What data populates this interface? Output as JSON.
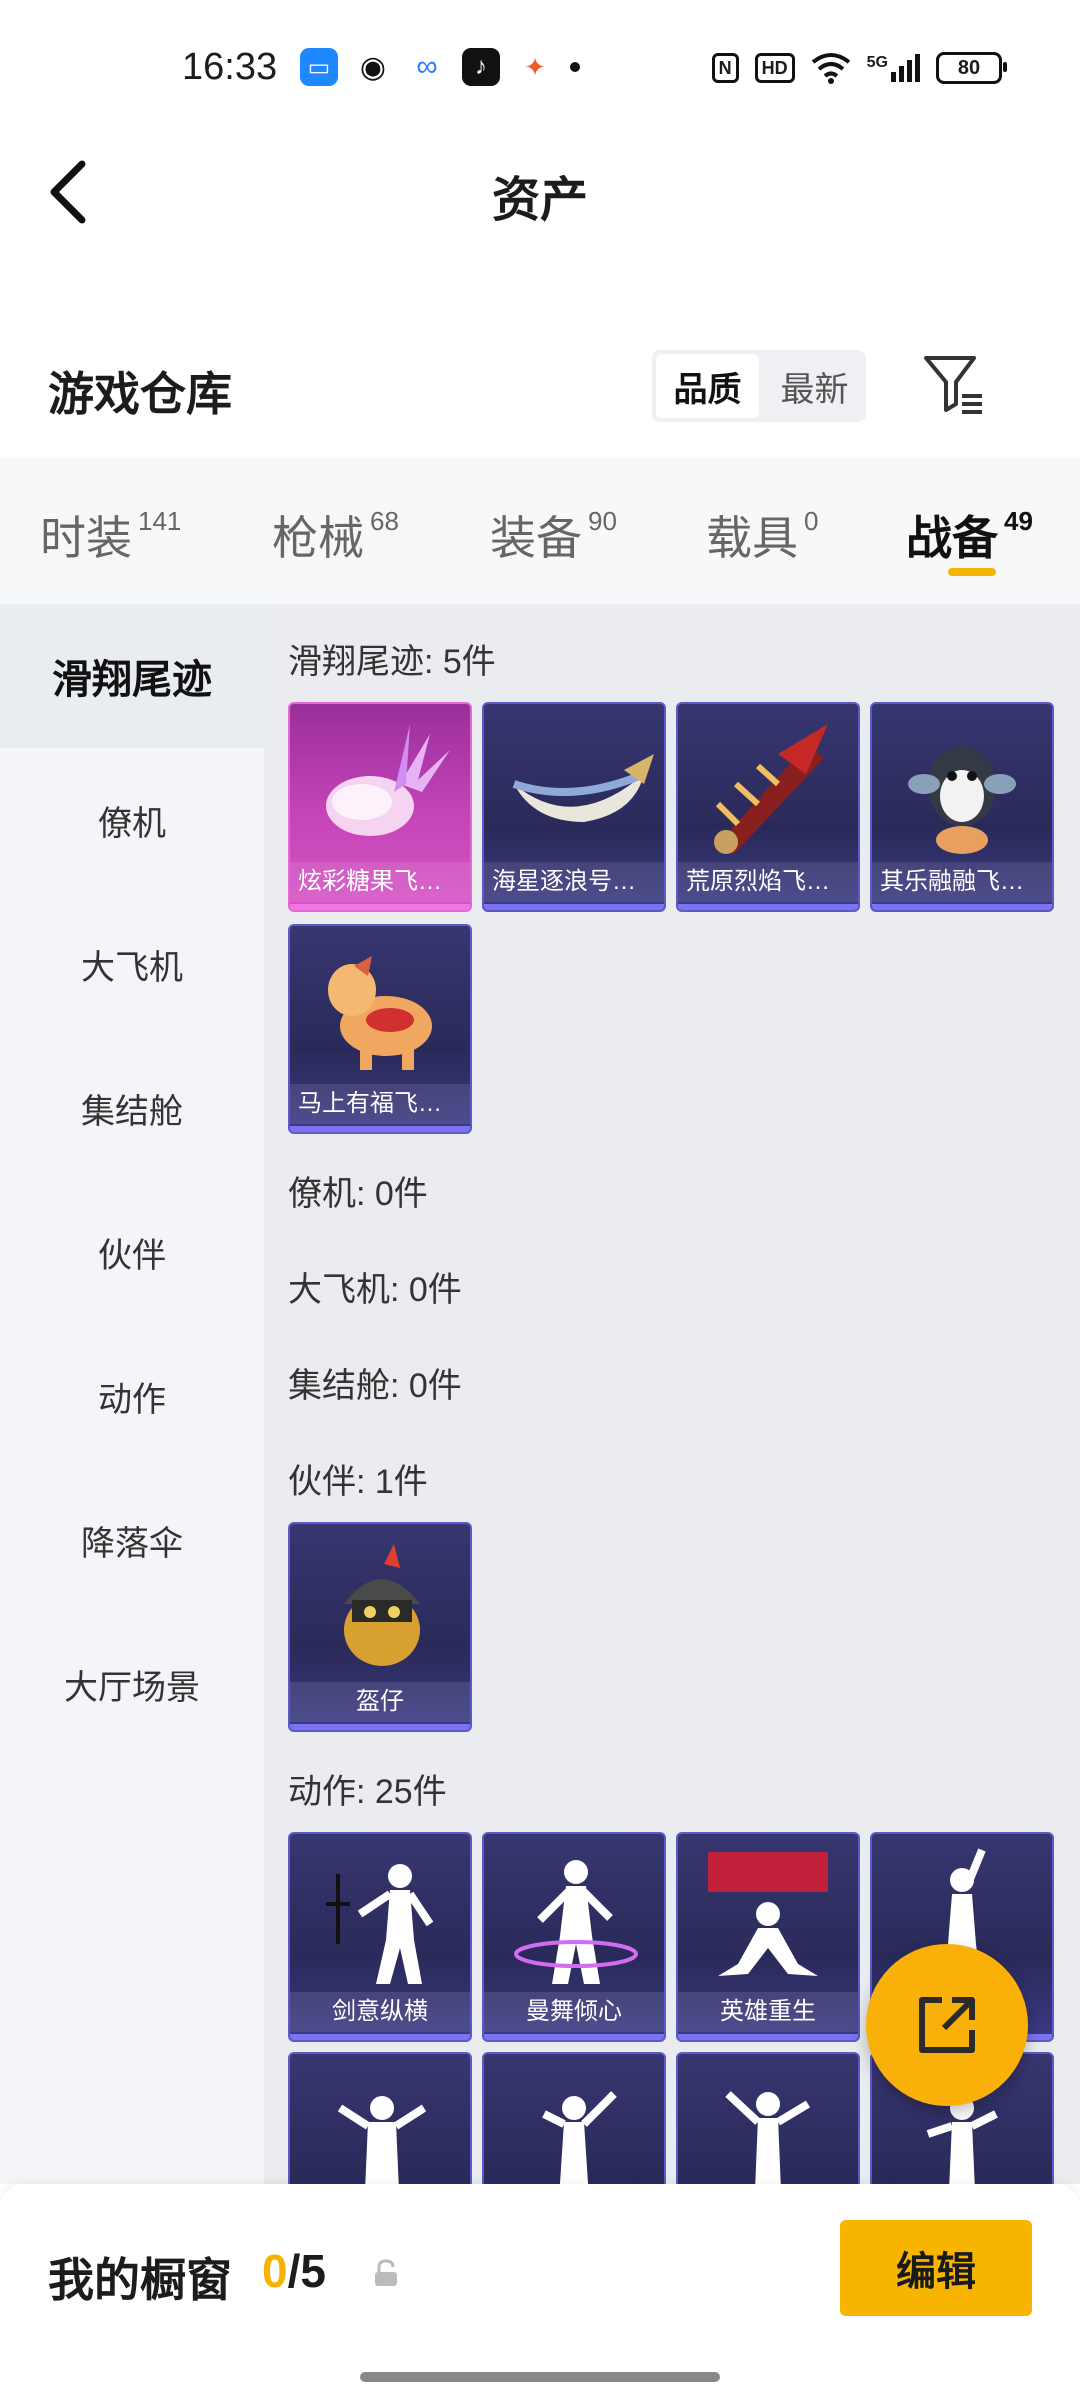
{
  "status_bar": {
    "time": "16:33",
    "icons": [
      "calendar-icon",
      "wechat-icon",
      "cloud-icon",
      "tiktok-icon",
      "game-icon"
    ],
    "right_icons": [
      "nfc-icon",
      "hd-icon",
      "wifi-icon",
      "5g-signal-icon"
    ],
    "hd_label": "HD",
    "nfc_label": "N",
    "net_label": "5G",
    "battery": "80"
  },
  "header": {
    "title": "资产"
  },
  "warehouse": {
    "title": "游戏仓库",
    "sort_options": [
      "品质",
      "最新"
    ],
    "selected_sort": "品质"
  },
  "tabs": [
    {
      "label": "时装",
      "count": "141"
    },
    {
      "label": "枪械",
      "count": "68"
    },
    {
      "label": "装备",
      "count": "90"
    },
    {
      "label": "载具",
      "count": "0"
    },
    {
      "label": "战备",
      "count": "49"
    }
  ],
  "active_tab": "战备",
  "sidebar": [
    "滑翔尾迹",
    "僚机",
    "大飞机",
    "集结舱",
    "伙伴",
    "动作",
    "降落伞",
    "大厅场景"
  ],
  "sections": {
    "glide": {
      "label": "滑翔尾迹: 5件",
      "items": [
        "炫彩糖果飞行器",
        "海星逐浪号飞行器",
        "荒原烈焰飞行器",
        "其乐融融飞行器",
        "马上有福飞行器"
      ]
    },
    "wingman": {
      "label": "僚机: 0件"
    },
    "plane": {
      "label": "大飞机: 0件"
    },
    "pod": {
      "label": "集结舱: 0件"
    },
    "partner": {
      "label": "伙伴: 1件",
      "items": [
        "盔仔"
      ]
    },
    "emote": {
      "label": "动作: 25件",
      "items": [
        "剑意纵横",
        "曼舞倾心",
        "英雄重生"
      ]
    }
  },
  "bottom": {
    "my_window": "我的橱窗",
    "current": "0",
    "slash_total": "/5",
    "edit": "编辑"
  },
  "colors": {
    "accent": "#f5b400",
    "card_purple": "#373671",
    "card_pink": "#c545b8"
  }
}
